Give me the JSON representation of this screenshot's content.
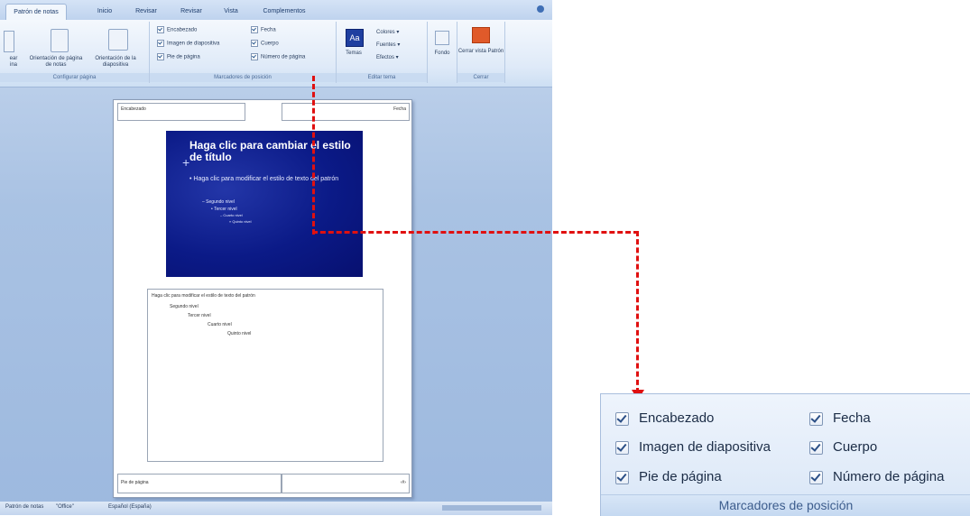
{
  "app": {
    "tabs": [
      "Patrón de notas",
      "Inicio",
      "Revisar",
      "Revisar",
      "Vista",
      "Complementos"
    ],
    "ribbon": {
      "buttons": [
        "Configurar página",
        "Orientación de página de notas",
        "Orientación de la diapositiva"
      ],
      "checks": [
        "Encabezado",
        "Imagen de diapositiva",
        "Pie de página",
        "Fecha",
        "Cuerpo",
        "Número de página"
      ],
      "theme_items": [
        "Temas",
        "Colores",
        "Fuentes",
        "Efectos"
      ],
      "other_buttons": [
        "Fondo",
        "Cerrar vista Patrón"
      ],
      "group_labels": [
        "Configurar página",
        "Marcadores de posición",
        "Editar tema",
        "Cerrar"
      ]
    },
    "page": {
      "header": "Encabezado",
      "date": "Fecha",
      "footer": "Pie de página",
      "page_num": "‹#›",
      "slide_title": "Haga clic para cambiar el estilo de título",
      "slide_bullets": [
        "Haga clic para modificar el estilo de texto del patrón",
        "Segundo nivel",
        "Tercer nivel",
        "Cuarto nivel",
        "Quinto nivel"
      ],
      "notes_lines": [
        "Haga clic para modificar el estilo de texto del patrón",
        "Segundo nivel",
        "Tercer nivel",
        "Cuarto nivel",
        "Quinto nivel"
      ]
    },
    "status": [
      "Patrón de notas",
      "\"Office\"",
      "Español (España)"
    ]
  },
  "zoom_panel": {
    "checks": {
      "encabezado": "Encabezado",
      "imagen": "Imagen de diapositiva",
      "pie": "Pie de página",
      "fecha": "Fecha",
      "cuerpo": "Cuerpo",
      "numero": "Número de página"
    },
    "group_label": "Marcadores de posición"
  },
  "colors": {
    "arrow": "#e01010",
    "slide_bg": "#0b1a87",
    "ribbon_bg": "#dfeaf8"
  }
}
